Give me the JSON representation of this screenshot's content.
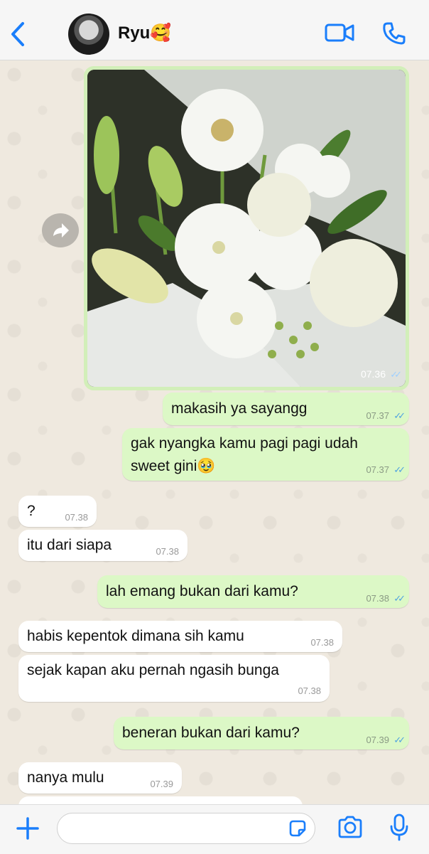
{
  "header": {
    "contact_name": "Ryu🥰",
    "icons": [
      "back-chevron-icon",
      "video-call-icon",
      "phone-call-icon"
    ]
  },
  "messages": [
    {
      "id": "m0",
      "direction": "outgoing",
      "type": "image",
      "time": "07.36",
      "read": true,
      "image_description": "bouquet of white flowers"
    },
    {
      "id": "m1",
      "direction": "outgoing",
      "text": "makasih ya sayangg",
      "time": "07.37",
      "read": true
    },
    {
      "id": "m2",
      "direction": "outgoing",
      "text_line1": "gak nyangka kamu pagi pagi udah",
      "text_line2": "sweet gini🥹",
      "time": "07.37",
      "read": true
    },
    {
      "id": "m3",
      "direction": "incoming",
      "text": "?",
      "time": "07.38"
    },
    {
      "id": "m4",
      "direction": "incoming",
      "text": "itu dari siapa",
      "time": "07.38"
    },
    {
      "id": "m5",
      "direction": "outgoing",
      "text": "lah emang bukan dari kamu?",
      "time": "07.38",
      "read": true
    },
    {
      "id": "m6",
      "direction": "incoming",
      "text": "habis kepentok dimana sih kamu",
      "time": "07.38"
    },
    {
      "id": "m7",
      "direction": "incoming",
      "text": "sejak kapan aku pernah ngasih bunga",
      "time": "07.38"
    },
    {
      "id": "m8",
      "direction": "outgoing",
      "text": "beneran bukan dari kamu?",
      "time": "07.39",
      "read": true
    },
    {
      "id": "m9",
      "direction": "incoming",
      "text": "nanya mulu",
      "time": "07.39"
    }
  ],
  "input_bar": {
    "message_placeholder": "",
    "icons": [
      "plus-icon",
      "sticker-icon",
      "camera-icon",
      "microphone-icon"
    ]
  },
  "colors": {
    "accent": "#1a7efb",
    "outgoing_bubble": "#dcf8c6",
    "incoming_bubble": "#ffffff",
    "read_ticks": "#4fa3e0"
  }
}
